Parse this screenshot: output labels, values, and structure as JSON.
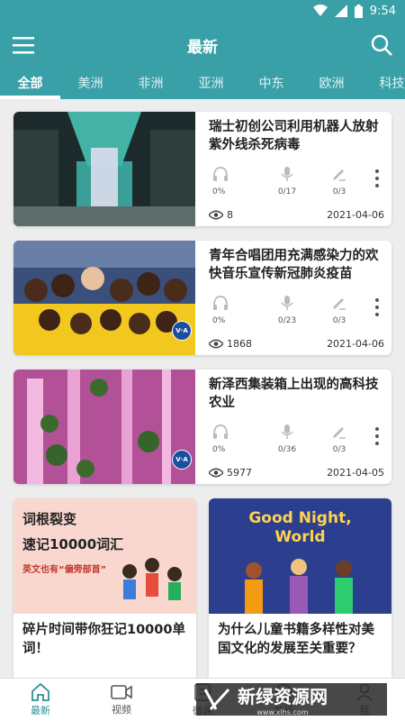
{
  "status": {
    "time": "9:54"
  },
  "header": {
    "title": "最新"
  },
  "tabs": [
    {
      "label": "全部",
      "active": true
    },
    {
      "label": "美洲"
    },
    {
      "label": "非洲"
    },
    {
      "label": "亚洲"
    },
    {
      "label": "中东"
    },
    {
      "label": "欧洲"
    },
    {
      "label": "科技"
    }
  ],
  "cards": [
    {
      "title": "瑞士初创公司利用机器人放射紫外线杀死病毒",
      "listen": "0%",
      "speak": "0/17",
      "write": "0/3",
      "views": "8",
      "date": "2021-04-06"
    },
    {
      "title": "青年合唱团用充满感染力的欢快音乐宣传新冠肺炎疫苗",
      "listen": "0%",
      "speak": "0/23",
      "write": "0/3",
      "views": "1868",
      "date": "2021-04-06"
    },
    {
      "title": "新泽西集装箱上出现的高科技农业",
      "listen": "0%",
      "speak": "0/36",
      "write": "0/3",
      "views": "5977",
      "date": "2021-04-05"
    }
  ],
  "grid": [
    {
      "title": "碎片时间带你狂记10000单词！",
      "img_line1": "词根裂变",
      "img_line2": "速记10000词汇",
      "img_line3": "英文也有“偏旁部首”"
    },
    {
      "title": "为什么儿童书籍多样性对美国文化的发展至关重要？",
      "img_text": "Good Night, World"
    }
  ],
  "voa_label": "V·A",
  "nav": [
    {
      "label": "最新",
      "active": true
    },
    {
      "label": "视频"
    },
    {
      "label": "微课"
    },
    {
      "label": "发现"
    },
    {
      "label": "我"
    }
  ],
  "watermark": {
    "main": "新绿资源网",
    "sub": "www.xlhs.com"
  },
  "colors": {
    "accent": "#3aa0a8",
    "active_nav": "#2f8f98"
  }
}
